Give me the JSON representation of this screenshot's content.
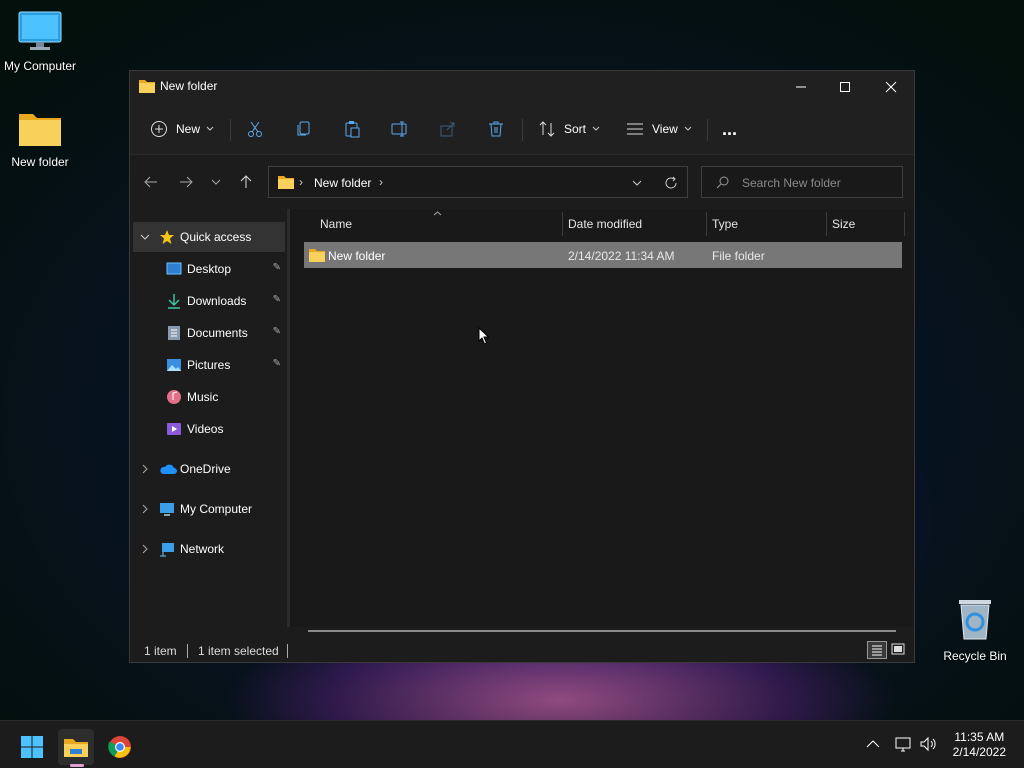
{
  "desktop": {
    "icons": [
      {
        "label": "My Computer"
      },
      {
        "label": "New folder"
      },
      {
        "label": "Recycle Bin"
      }
    ]
  },
  "window": {
    "title": "New folder",
    "toolbar": {
      "new_label": "New",
      "sort_label": "Sort",
      "view_label": "View",
      "more_label": "..."
    },
    "address": {
      "path": "New folder",
      "search_placeholder": "Search New folder"
    },
    "sidebar": {
      "quick_access": "Quick access",
      "items": [
        {
          "label": "Desktop",
          "pinned": true
        },
        {
          "label": "Downloads",
          "pinned": true
        },
        {
          "label": "Documents",
          "pinned": true
        },
        {
          "label": "Pictures",
          "pinned": true
        },
        {
          "label": "Music",
          "pinned": false
        },
        {
          "label": "Videos",
          "pinned": false
        }
      ],
      "roots": [
        {
          "label": "OneDrive"
        },
        {
          "label": "My Computer"
        },
        {
          "label": "Network"
        }
      ]
    },
    "columns": [
      "Name",
      "Date modified",
      "Type",
      "Size"
    ],
    "rows": [
      {
        "name": "New folder",
        "date": "2/14/2022 11:34 AM",
        "type": "File folder",
        "size": ""
      }
    ],
    "status": {
      "count": "1 item",
      "selected": "1 item selected"
    }
  },
  "taskbar": {
    "time": "11:35 AM",
    "date": "2/14/2022"
  },
  "colors": {
    "accent": "#4cc2ff",
    "folder": "#f8c53a",
    "selection": "#777777"
  }
}
